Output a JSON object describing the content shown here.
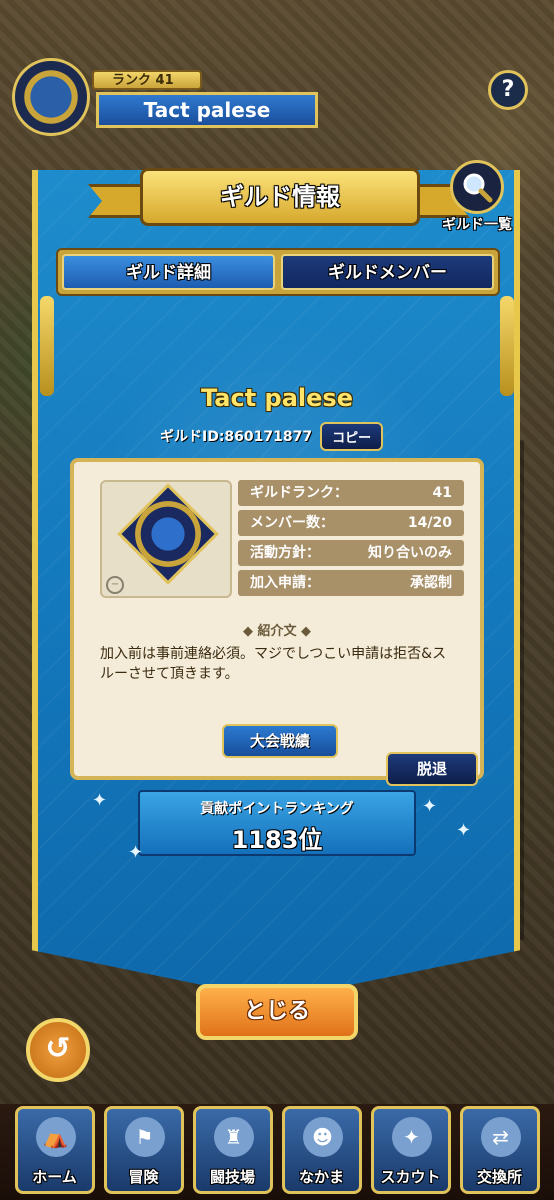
{
  "player": {
    "rank": "ランク 41",
    "name": "Tact palese"
  },
  "help_label": "?",
  "dialog": {
    "title": "ギルド情報",
    "guild_list_label": "ギルド一覧",
    "tabs": [
      {
        "label": "ギルド詳細",
        "active": true
      },
      {
        "label": "ギルドメンバー",
        "active": false
      }
    ],
    "guild_name": "Tact palese",
    "guild_id": "ギルドID:860171877",
    "copy_label": "コピー",
    "stats": [
      {
        "label": "ギルドランク：",
        "value": "41"
      },
      {
        "label": "メンバー数：",
        "value": "14/20"
      },
      {
        "label": "活動方針：",
        "value": "知り合いのみ"
      },
      {
        "label": "加入申請：",
        "value": "承認制"
      }
    ],
    "intro_header": "紹介文",
    "intro_text": "加入前は事前連絡必須。マジでしつこい申請は拒否&スルーさせて頂きます。",
    "tournament_label": "大会戦績",
    "leave_label": "脱退",
    "ranking_label": "貢献ポイントランキング",
    "ranking_value": "1183位",
    "close_label": "とじる"
  },
  "nav": [
    {
      "label": "ホーム",
      "icon": "tent-icon"
    },
    {
      "label": "冒険",
      "icon": "wagon-icon"
    },
    {
      "label": "闘技場",
      "icon": "castle-icon"
    },
    {
      "label": "なかま",
      "icon": "monsters-icon"
    },
    {
      "label": "スカウト",
      "icon": "scout-icon"
    },
    {
      "label": "交換所",
      "icon": "exchange-icon"
    }
  ],
  "colors": {
    "banner": "#1479bd",
    "gold": "#e0c35a",
    "close_orange": "#e0721a"
  }
}
